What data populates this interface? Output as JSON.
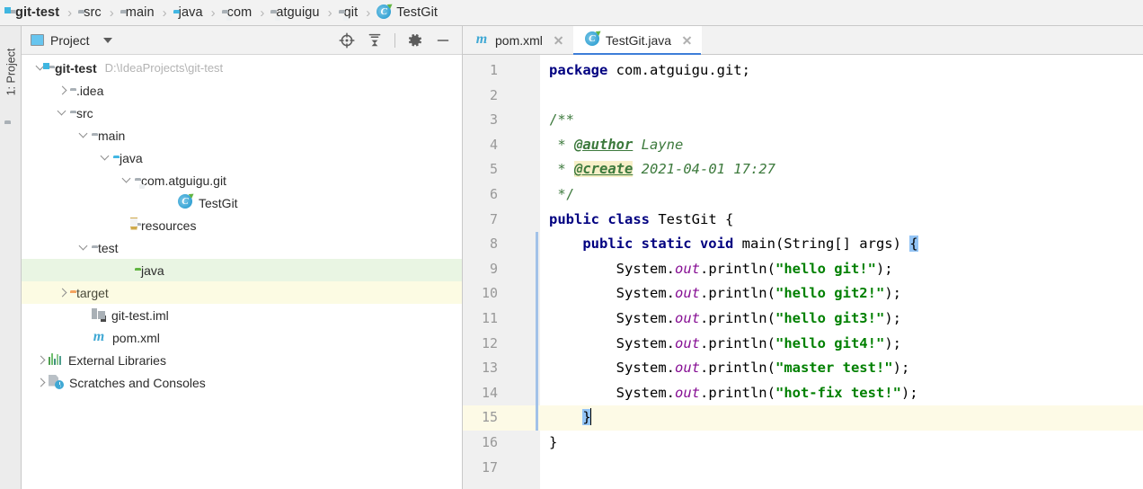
{
  "breadcrumb": {
    "items": [
      {
        "label": "git-test",
        "icon": "folder-module-icon",
        "bold": true
      },
      {
        "label": "src",
        "icon": "folder-icon",
        "bold": false
      },
      {
        "label": "main",
        "icon": "folder-icon",
        "bold": false
      },
      {
        "label": "java",
        "icon": "folder-source-icon",
        "bold": false
      },
      {
        "label": "com",
        "icon": "folder-package-icon",
        "bold": false
      },
      {
        "label": "atguigu",
        "icon": "folder-package-icon",
        "bold": false
      },
      {
        "label": "git",
        "icon": "folder-package-icon",
        "bold": false
      },
      {
        "label": "TestGit",
        "icon": "java-class-icon",
        "bold": false
      }
    ],
    "separator": "›"
  },
  "rail": {
    "project_button_label": "1: Project",
    "project_button_icon": "folder-icon"
  },
  "project_panel": {
    "title": "Project",
    "title_icon": "project-view-icon",
    "dropdown_icon": "chevron-down-icon",
    "tools": [
      {
        "name": "scroll-from-source-icon",
        "tooltip": "Select Opened File"
      },
      {
        "name": "collapse-all-icon",
        "tooltip": "Collapse All"
      },
      {
        "name": "gear-icon",
        "tooltip": "Settings"
      },
      {
        "name": "minimize-icon",
        "tooltip": "Hide"
      }
    ],
    "tree": [
      {
        "label": "git-test",
        "sub": "D:\\IdeaProjects\\git-test",
        "indent": 0,
        "expander": "down",
        "icon": "folder-module-icon",
        "bold": true,
        "highlight": "none"
      },
      {
        "label": ".idea",
        "sub": "",
        "indent": 1,
        "expander": "right",
        "icon": "folder-icon",
        "bold": false,
        "highlight": "none"
      },
      {
        "label": "src",
        "sub": "",
        "indent": 1,
        "expander": "down",
        "icon": "folder-icon",
        "bold": false,
        "highlight": "none"
      },
      {
        "label": "main",
        "sub": "",
        "indent": 2,
        "expander": "down",
        "icon": "folder-icon",
        "bold": false,
        "highlight": "none"
      },
      {
        "label": "java",
        "sub": "",
        "indent": 3,
        "expander": "down",
        "icon": "folder-source-icon",
        "bold": false,
        "highlight": "none"
      },
      {
        "label": "com.atguigu.git",
        "sub": "",
        "indent": 4,
        "expander": "down",
        "icon": "folder-package-icon",
        "bold": false,
        "highlight": "none"
      },
      {
        "label": "TestGit",
        "sub": "",
        "indent": 6,
        "expander": "none",
        "icon": "java-class-icon",
        "bold": false,
        "highlight": "none"
      },
      {
        "label": "resources",
        "sub": "",
        "indent": 4,
        "expander": "none",
        "icon": "folder-resources-icon",
        "bold": false,
        "highlight": "none"
      },
      {
        "label": "test",
        "sub": "",
        "indent": 2,
        "expander": "down",
        "icon": "folder-icon",
        "bold": false,
        "highlight": "none"
      },
      {
        "label": "java",
        "sub": "",
        "indent": 4,
        "expander": "none",
        "icon": "folder-test-source-icon",
        "bold": false,
        "highlight": "green"
      },
      {
        "label": "target",
        "sub": "",
        "indent": 1,
        "expander": "right",
        "icon": "folder-excluded-icon",
        "bold": false,
        "highlight": "yellow"
      },
      {
        "label": "git-test.iml",
        "sub": "",
        "indent": 2,
        "expander": "none",
        "icon": "iml-file-icon",
        "bold": false,
        "highlight": "none"
      },
      {
        "label": "pom.xml",
        "sub": "",
        "indent": 2,
        "expander": "none",
        "icon": "maven-file-icon",
        "bold": false,
        "highlight": "none"
      },
      {
        "label": "External Libraries",
        "sub": "",
        "indent": 0,
        "expander": "right",
        "icon": "libraries-icon",
        "bold": false,
        "highlight": "none"
      },
      {
        "label": "Scratches and Consoles",
        "sub": "",
        "indent": 0,
        "expander": "right",
        "icon": "scratches-icon",
        "bold": false,
        "highlight": "none"
      }
    ]
  },
  "editor": {
    "tabs": [
      {
        "label": "pom.xml",
        "icon": "maven-file-icon",
        "active": false,
        "close_icon": "close-icon"
      },
      {
        "label": "TestGit.java",
        "icon": "java-class-icon",
        "active": true,
        "close_icon": "close-icon"
      }
    ],
    "line_numbers": [
      "1",
      "2",
      "3",
      "4",
      "5",
      "6",
      "7",
      "8",
      "9",
      "10",
      "11",
      "12",
      "13",
      "14",
      "15",
      "16",
      "17"
    ],
    "caret_line": 15,
    "run_gutter_lines": [
      7,
      8
    ],
    "code_lines": [
      {
        "n": 1,
        "tokens": [
          {
            "t": "package ",
            "c": "kw"
          },
          {
            "t": "com.atguigu.git;",
            "c": "plain"
          }
        ]
      },
      {
        "n": 2,
        "tokens": []
      },
      {
        "n": 3,
        "tokens": [
          {
            "t": "/**",
            "c": "jdoc"
          }
        ]
      },
      {
        "n": 4,
        "tokens": [
          {
            "t": " * ",
            "c": "jdoc"
          },
          {
            "t": "@author",
            "c": "jdoc-tag"
          },
          {
            "t": " Layne",
            "c": "jdoc-it"
          }
        ]
      },
      {
        "n": 5,
        "tokens": [
          {
            "t": " * ",
            "c": "jdoc"
          },
          {
            "t": "@create",
            "c": "jdoc-tag-hl"
          },
          {
            "t": " 2021-04-01 17:27",
            "c": "jdoc-it"
          }
        ]
      },
      {
        "n": 6,
        "tokens": [
          {
            "t": " */",
            "c": "jdoc"
          }
        ]
      },
      {
        "n": 7,
        "tokens": [
          {
            "t": "public class ",
            "c": "kw"
          },
          {
            "t": "TestGit {",
            "c": "plain"
          }
        ]
      },
      {
        "n": 8,
        "tokens": [
          {
            "t": "    ",
            "c": "plain"
          },
          {
            "t": "public static void ",
            "c": "kw"
          },
          {
            "t": "main(String[] args) ",
            "c": "plain"
          },
          {
            "t": "{",
            "c": "brace-hl"
          }
        ]
      },
      {
        "n": 9,
        "tokens": [
          {
            "t": "        System.",
            "c": "plain"
          },
          {
            "t": "out",
            "c": "field-static"
          },
          {
            "t": ".println(",
            "c": "plain"
          },
          {
            "t": "\"hello git!\"",
            "c": "str"
          },
          {
            "t": ");",
            "c": "plain"
          }
        ]
      },
      {
        "n": 10,
        "tokens": [
          {
            "t": "        System.",
            "c": "plain"
          },
          {
            "t": "out",
            "c": "field-static"
          },
          {
            "t": ".println(",
            "c": "plain"
          },
          {
            "t": "\"hello git2!\"",
            "c": "str"
          },
          {
            "t": ");",
            "c": "plain"
          }
        ]
      },
      {
        "n": 11,
        "tokens": [
          {
            "t": "        System.",
            "c": "plain"
          },
          {
            "t": "out",
            "c": "field-static"
          },
          {
            "t": ".println(",
            "c": "plain"
          },
          {
            "t": "\"hello git3!\"",
            "c": "str"
          },
          {
            "t": ");",
            "c": "plain"
          }
        ]
      },
      {
        "n": 12,
        "tokens": [
          {
            "t": "        System.",
            "c": "plain"
          },
          {
            "t": "out",
            "c": "field-static"
          },
          {
            "t": ".println(",
            "c": "plain"
          },
          {
            "t": "\"hello git4!\"",
            "c": "str"
          },
          {
            "t": ");",
            "c": "plain"
          }
        ]
      },
      {
        "n": 13,
        "tokens": [
          {
            "t": "        System.",
            "c": "plain"
          },
          {
            "t": "out",
            "c": "field-static"
          },
          {
            "t": ".println(",
            "c": "plain"
          },
          {
            "t": "\"master test!\"",
            "c": "str"
          },
          {
            "t": ");",
            "c": "plain"
          }
        ]
      },
      {
        "n": 14,
        "tokens": [
          {
            "t": "        System.",
            "c": "plain"
          },
          {
            "t": "out",
            "c": "field-static"
          },
          {
            "t": ".println(",
            "c": "plain"
          },
          {
            "t": "\"hot-fix test!\"",
            "c": "str"
          },
          {
            "t": ");",
            "c": "plain"
          }
        ]
      },
      {
        "n": 15,
        "tokens": [
          {
            "t": "    ",
            "c": "plain"
          },
          {
            "t": "}",
            "c": "brace-hl"
          },
          {
            "t": "",
            "c": "caret"
          }
        ]
      },
      {
        "n": 16,
        "tokens": [
          {
            "t": "}",
            "c": "plain"
          }
        ]
      },
      {
        "n": 17,
        "tokens": []
      }
    ]
  },
  "colors": {
    "keyword": "#000080",
    "string": "#008000",
    "javadoc": "#3d7a3d",
    "static_field": "#871094",
    "brace_match": "#93c4f5",
    "caret_line_bg": "#fdfae6",
    "change_bar": "#a2c2e8",
    "tab_underline": "#3d7dd8",
    "test_source_bg": "#e9f5e3",
    "excluded_bg": "#fcfbe3",
    "panel_bg": "#f2f2f2"
  }
}
